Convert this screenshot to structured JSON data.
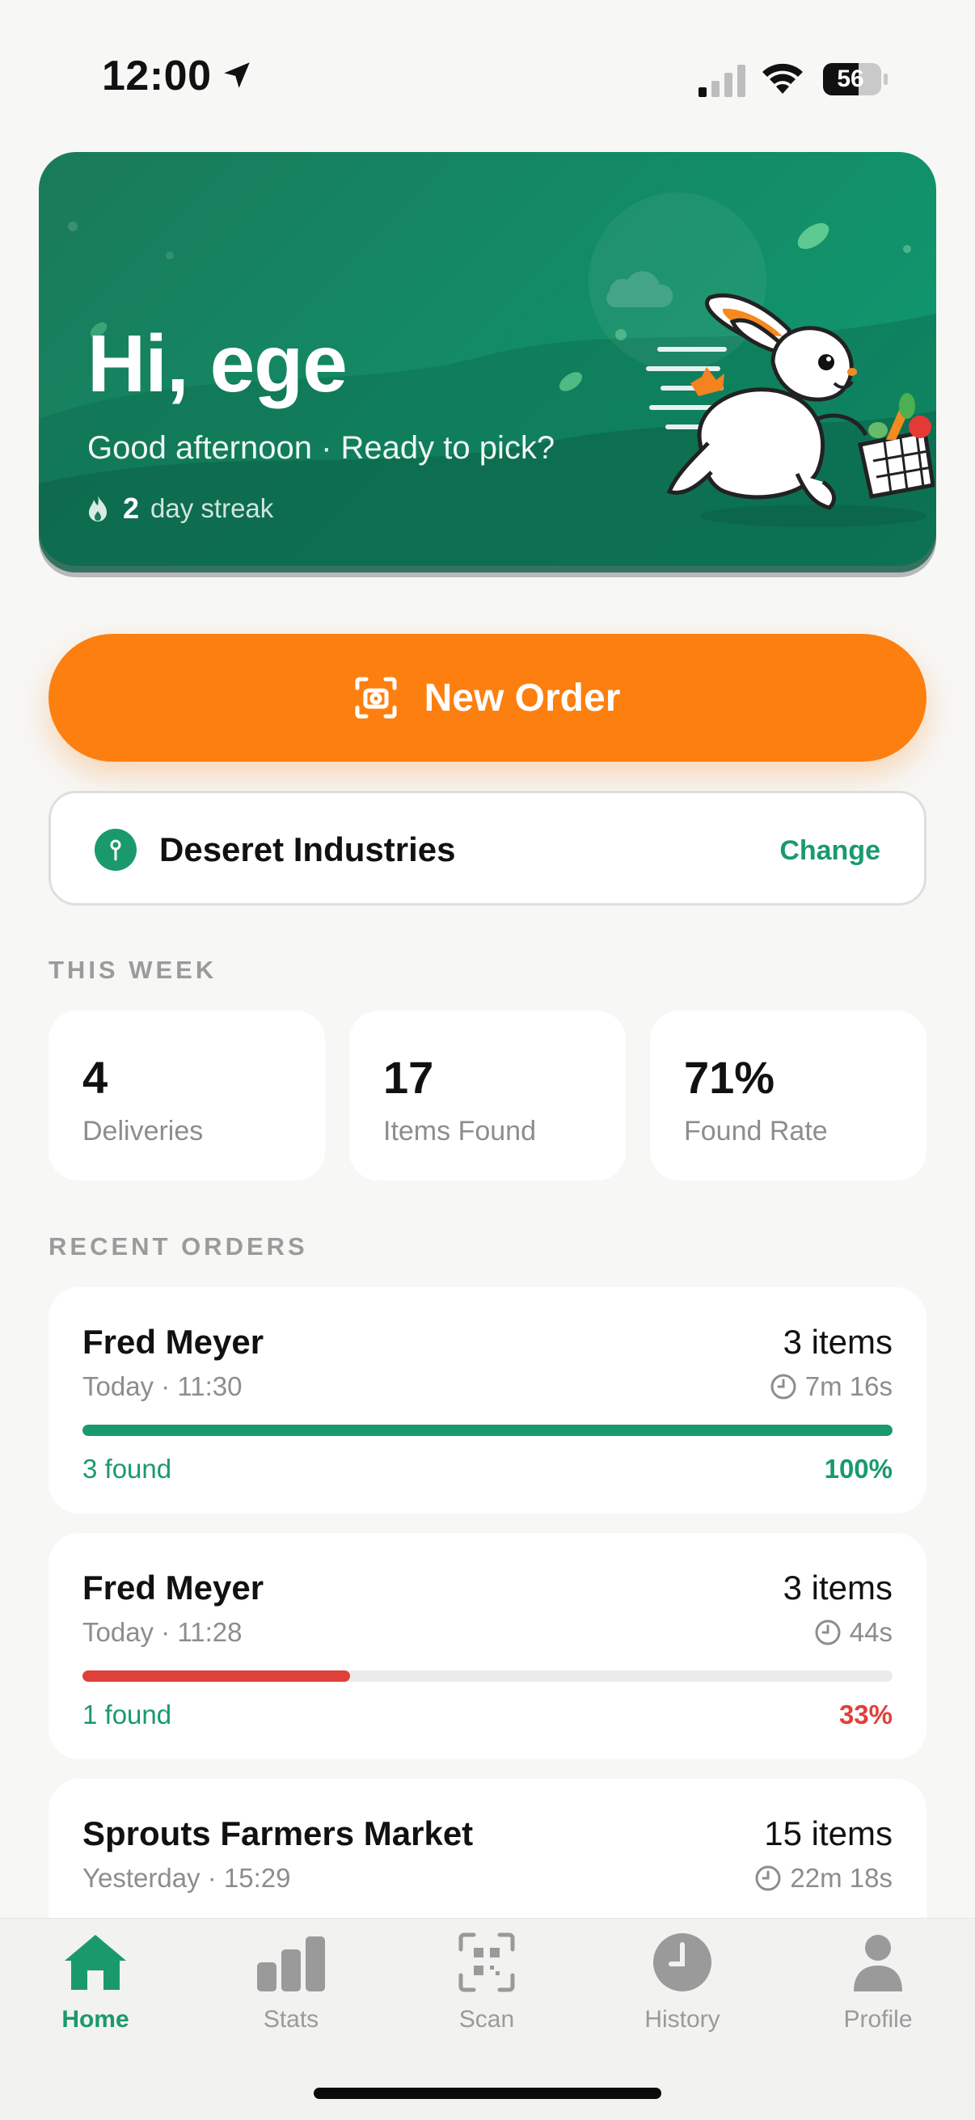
{
  "status_bar": {
    "time": "12:00",
    "battery": "56"
  },
  "hero": {
    "title": "Hi, ege",
    "subtitle": "Good afternoon · Ready to pick?",
    "streak_count": "2",
    "streak_label": "day streak",
    "icon": "flame-icon"
  },
  "new_order": {
    "label": "New Order",
    "icon": "camera-scan-icon"
  },
  "store": {
    "name": "Deseret Industries",
    "change_label": "Change",
    "icon": "location-pin-icon"
  },
  "this_week": {
    "heading": "THIS WEEK",
    "stats": [
      {
        "value": "4",
        "label": "Deliveries"
      },
      {
        "value": "17",
        "label": "Items Found"
      },
      {
        "value": "71%",
        "label": "Found Rate"
      }
    ]
  },
  "recent_orders": {
    "heading": "RECENT ORDERS",
    "orders": [
      {
        "store": "Fred Meyer",
        "items": "3 items",
        "time": "Today · 11:30",
        "duration": "7m 16s",
        "found": "3 found",
        "percent": "100%",
        "progress": 1.0,
        "color": "#1a9a6c"
      },
      {
        "store": "Fred Meyer",
        "items": "3 items",
        "time": "Today · 11:28",
        "duration": "44s",
        "found": "1 found",
        "percent": "33%",
        "progress": 0.33,
        "color": "#e0403a"
      },
      {
        "store": "Sprouts Farmers Market",
        "items": "15 items",
        "time": "Yesterday · 15:29",
        "duration": "22m 18s"
      }
    ]
  },
  "tabs": [
    {
      "label": "Home",
      "icon": "home-icon",
      "active": true
    },
    {
      "label": "Stats",
      "icon": "bar-chart-icon"
    },
    {
      "label": "Scan",
      "icon": "qr-scan-icon"
    },
    {
      "label": "History",
      "icon": "clock-icon"
    },
    {
      "label": "Profile",
      "icon": "person-icon"
    }
  ],
  "colors": {
    "accent": "#1a9a6c",
    "orange": "#fd7f0f",
    "danger": "#e0403a"
  }
}
